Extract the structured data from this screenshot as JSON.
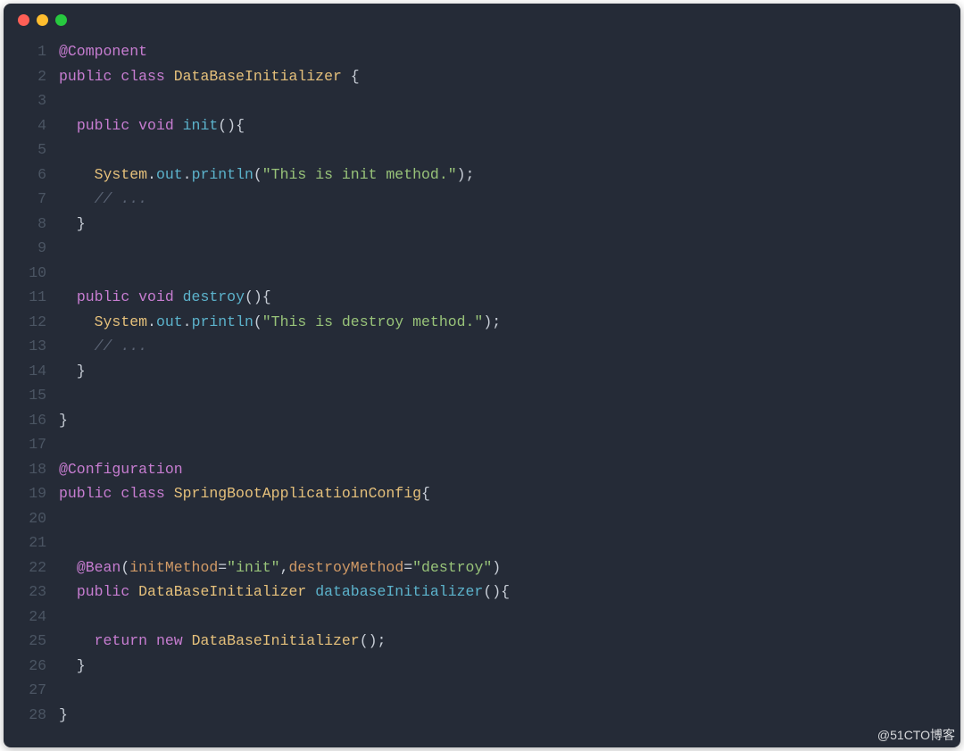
{
  "watermark": "@51CTO博客",
  "lines": [
    {
      "n": "1",
      "segs": [
        [
          "ann",
          "@Component"
        ]
      ]
    },
    {
      "n": "2",
      "segs": [
        [
          "kw",
          "public"
        ],
        [
          "punc",
          " "
        ],
        [
          "kw",
          "class"
        ],
        [
          "punc",
          " "
        ],
        [
          "type",
          "DataBaseInitializer"
        ],
        [
          "punc",
          " {"
        ]
      ]
    },
    {
      "n": "3",
      "segs": []
    },
    {
      "n": "4",
      "segs": [
        [
          "punc",
          "  "
        ],
        [
          "kw",
          "public"
        ],
        [
          "punc",
          " "
        ],
        [
          "kw",
          "void"
        ],
        [
          "punc",
          " "
        ],
        [
          "fn",
          "init"
        ],
        [
          "punc",
          "(){"
        ]
      ]
    },
    {
      "n": "5",
      "segs": []
    },
    {
      "n": "6",
      "segs": [
        [
          "punc",
          "    "
        ],
        [
          "type",
          "System"
        ],
        [
          "punc",
          "."
        ],
        [
          "fn",
          "out"
        ],
        [
          "punc",
          "."
        ],
        [
          "fn",
          "println"
        ],
        [
          "punc",
          "("
        ],
        [
          "str",
          "\"This is init method.\""
        ],
        [
          "punc",
          ");"
        ]
      ]
    },
    {
      "n": "7",
      "segs": [
        [
          "punc",
          "    "
        ],
        [
          "cmt",
          "// ..."
        ]
      ]
    },
    {
      "n": "8",
      "segs": [
        [
          "punc",
          "  }"
        ]
      ]
    },
    {
      "n": "9",
      "segs": []
    },
    {
      "n": "10",
      "segs": []
    },
    {
      "n": "11",
      "segs": [
        [
          "punc",
          "  "
        ],
        [
          "kw",
          "public"
        ],
        [
          "punc",
          " "
        ],
        [
          "kw",
          "void"
        ],
        [
          "punc",
          " "
        ],
        [
          "fn",
          "destroy"
        ],
        [
          "punc",
          "(){"
        ]
      ]
    },
    {
      "n": "12",
      "segs": [
        [
          "punc",
          "    "
        ],
        [
          "type",
          "System"
        ],
        [
          "punc",
          "."
        ],
        [
          "fn",
          "out"
        ],
        [
          "punc",
          "."
        ],
        [
          "fn",
          "println"
        ],
        [
          "punc",
          "("
        ],
        [
          "str",
          "\"This is destroy method.\""
        ],
        [
          "punc",
          ");"
        ]
      ]
    },
    {
      "n": "13",
      "segs": [
        [
          "punc",
          "    "
        ],
        [
          "cmt",
          "// ..."
        ]
      ]
    },
    {
      "n": "14",
      "segs": [
        [
          "punc",
          "  }"
        ]
      ]
    },
    {
      "n": "15",
      "segs": []
    },
    {
      "n": "16",
      "segs": [
        [
          "punc",
          "}"
        ]
      ]
    },
    {
      "n": "17",
      "segs": []
    },
    {
      "n": "18",
      "segs": [
        [
          "ann",
          "@Configuration"
        ]
      ]
    },
    {
      "n": "19",
      "segs": [
        [
          "kw",
          "public"
        ],
        [
          "punc",
          " "
        ],
        [
          "kw",
          "class"
        ],
        [
          "punc",
          " "
        ],
        [
          "type",
          "SpringBootApplicatioinConfig"
        ],
        [
          "punc",
          "{"
        ]
      ]
    },
    {
      "n": "20",
      "segs": []
    },
    {
      "n": "21",
      "segs": []
    },
    {
      "n": "22",
      "segs": [
        [
          "punc",
          "  "
        ],
        [
          "ann",
          "@Bean"
        ],
        [
          "punc",
          "("
        ],
        [
          "param",
          "initMethod"
        ],
        [
          "punc",
          "="
        ],
        [
          "str",
          "\"init\""
        ],
        [
          "punc",
          ","
        ],
        [
          "param",
          "destroyMethod"
        ],
        [
          "punc",
          "="
        ],
        [
          "str",
          "\"destroy\""
        ],
        [
          "punc",
          ")"
        ]
      ]
    },
    {
      "n": "23",
      "segs": [
        [
          "punc",
          "  "
        ],
        [
          "kw",
          "public"
        ],
        [
          "punc",
          " "
        ],
        [
          "type",
          "DataBaseInitializer"
        ],
        [
          "punc",
          " "
        ],
        [
          "fn",
          "databaseInitializer"
        ],
        [
          "punc",
          "(){"
        ]
      ]
    },
    {
      "n": "24",
      "segs": []
    },
    {
      "n": "25",
      "segs": [
        [
          "punc",
          "    "
        ],
        [
          "kw",
          "return"
        ],
        [
          "punc",
          " "
        ],
        [
          "kw",
          "new"
        ],
        [
          "punc",
          " "
        ],
        [
          "type",
          "DataBaseInitializer"
        ],
        [
          "punc",
          "();"
        ]
      ]
    },
    {
      "n": "26",
      "segs": [
        [
          "punc",
          "  }"
        ]
      ]
    },
    {
      "n": "27",
      "segs": []
    },
    {
      "n": "28",
      "segs": [
        [
          "punc",
          "}"
        ]
      ]
    }
  ]
}
